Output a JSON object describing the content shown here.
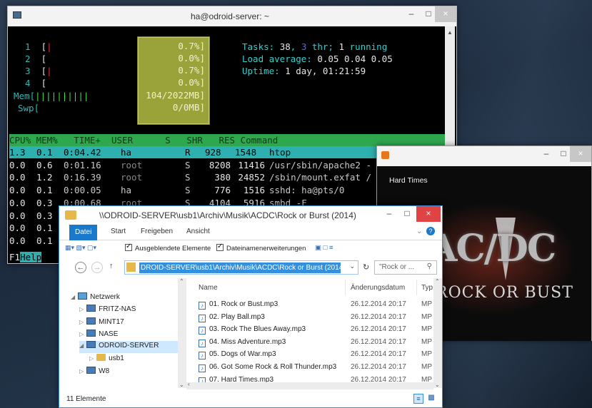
{
  "terminal": {
    "title": "ha@odroid-server: ~",
    "cpu_rows": [
      {
        "num": "1",
        "pct": "0.7%]"
      },
      {
        "num": "2",
        "pct": "0.0%]"
      },
      {
        "num": "3",
        "pct": "0.7%]"
      },
      {
        "num": "4",
        "pct": "0.0%]"
      }
    ],
    "mem_label": "Mem[",
    "mem_bars": "||||||||||",
    "mem_value": "104/2022MB]",
    "swp_label": "Swp[",
    "swp_value": "0/0MB]",
    "tasks_prefix": "Tasks: ",
    "tasks_count": "38",
    "tasks_sep": ", ",
    "thr_count": "3",
    "thr_label": " thr; ",
    "running_count": "1",
    "running_label": " running",
    "load_label": "Load average: ",
    "load_values": "0.05 0.04 0.05",
    "uptime_label": "Uptime: ",
    "uptime_value": "1 day, 01:21:59",
    "header": "CPU% MEM%   TIME+  USER      S   SHR   RES Command",
    "processes": [
      {
        "cpu": "1.3",
        "mem": "0.1",
        "time": "0:04.42",
        "user": "ha",
        "s": "R",
        "shr": "928",
        "res": "1548",
        "cmd": "htop"
      },
      {
        "cpu": "0.0",
        "mem": "0.6",
        "time": "0:01.16",
        "user": "root",
        "s": "S",
        "shr": "8208",
        "res": "11416",
        "cmd": "/usr/sbin/apache2 -"
      },
      {
        "cpu": "0.0",
        "mem": "1.2",
        "time": "0:16.39",
        "user": "root",
        "s": "S",
        "shr": "380",
        "res": "24852",
        "cmd": "/sbin/mount.exfat /"
      },
      {
        "cpu": "0.0",
        "mem": "0.1",
        "time": "0:00.05",
        "user": "ha",
        "s": "S",
        "shr": "776",
        "res": "1516",
        "cmd": "sshd: ha@pts/0"
      },
      {
        "cpu": "0.0",
        "mem": "0.3",
        "time": "0:00.68",
        "user": "root",
        "s": "S",
        "shr": "4104",
        "res": "5916",
        "cmd": "smbd -F"
      },
      {
        "cpu": "0.0",
        "mem": "0.3",
        "time": "",
        "user": "",
        "s": "",
        "shr": "",
        "res": "",
        "cmd": ""
      },
      {
        "cpu": "0.0",
        "mem": "0.1",
        "time": "",
        "user": "",
        "s": "",
        "shr": "",
        "res": "",
        "cmd": ""
      },
      {
        "cpu": "0.0",
        "mem": "0.1",
        "time": "",
        "user": "",
        "s": "",
        "shr": "",
        "res": "",
        "cmd": ""
      }
    ],
    "f1_key": "F1",
    "f1_label": "Help"
  },
  "album": {
    "song": "Hard Times",
    "band": "AC/DC",
    "album_title": "ROCK OR BUST"
  },
  "explorer": {
    "title": "\\\\ODROID-SERVER\\usb1\\Archiv\\Musik\\ACDC\\Rock or Burst (2014)",
    "tabs": [
      "Datei",
      "Start",
      "Freigeben",
      "Ansicht"
    ],
    "hidden_items_label": "Ausgeblendete Elemente",
    "extensions_label": "Dateinamenerweiterungen",
    "address": "DROID-SERVER\\usb1\\Archiv\\Musik\\ACDC\\Rock or Burst (2014)",
    "search_placeholder": "\"Rock or ...",
    "nav": [
      {
        "label": "Netzwerk",
        "kind": "network"
      },
      {
        "label": "FRITZ-NAS",
        "kind": "pc"
      },
      {
        "label": "MINT17",
        "kind": "pc"
      },
      {
        "label": "NASE",
        "kind": "pc"
      },
      {
        "label": "ODROID-SERVER",
        "kind": "pc"
      },
      {
        "label": "usb1",
        "kind": "folder"
      },
      {
        "label": "W8",
        "kind": "pc"
      }
    ],
    "columns": {
      "name": "Name",
      "date": "Änderungsdatum",
      "type": "Typ"
    },
    "files": [
      {
        "name": "01. Rock or Bust.mp3",
        "date": "26.12.2014 20:17",
        "type": "MP"
      },
      {
        "name": "02. Play Ball.mp3",
        "date": "26.12.2014 20:17",
        "type": "MP"
      },
      {
        "name": "03. Rock The Blues Away.mp3",
        "date": "26.12.2014 20:17",
        "type": "MP"
      },
      {
        "name": "04. Miss Adventure.mp3",
        "date": "26.12.2014 20:17",
        "type": "MP"
      },
      {
        "name": "05. Dogs of War.mp3",
        "date": "26.12.2014 20:17",
        "type": "MP"
      },
      {
        "name": "06. Got Some Rock & Roll Thunder.mp3",
        "date": "26.12.2014 20:17",
        "type": "MP"
      },
      {
        "name": "07. Hard Times.mp3",
        "date": "26.12.2014 20:17",
        "type": "MP"
      }
    ],
    "status": "11 Elemente"
  }
}
